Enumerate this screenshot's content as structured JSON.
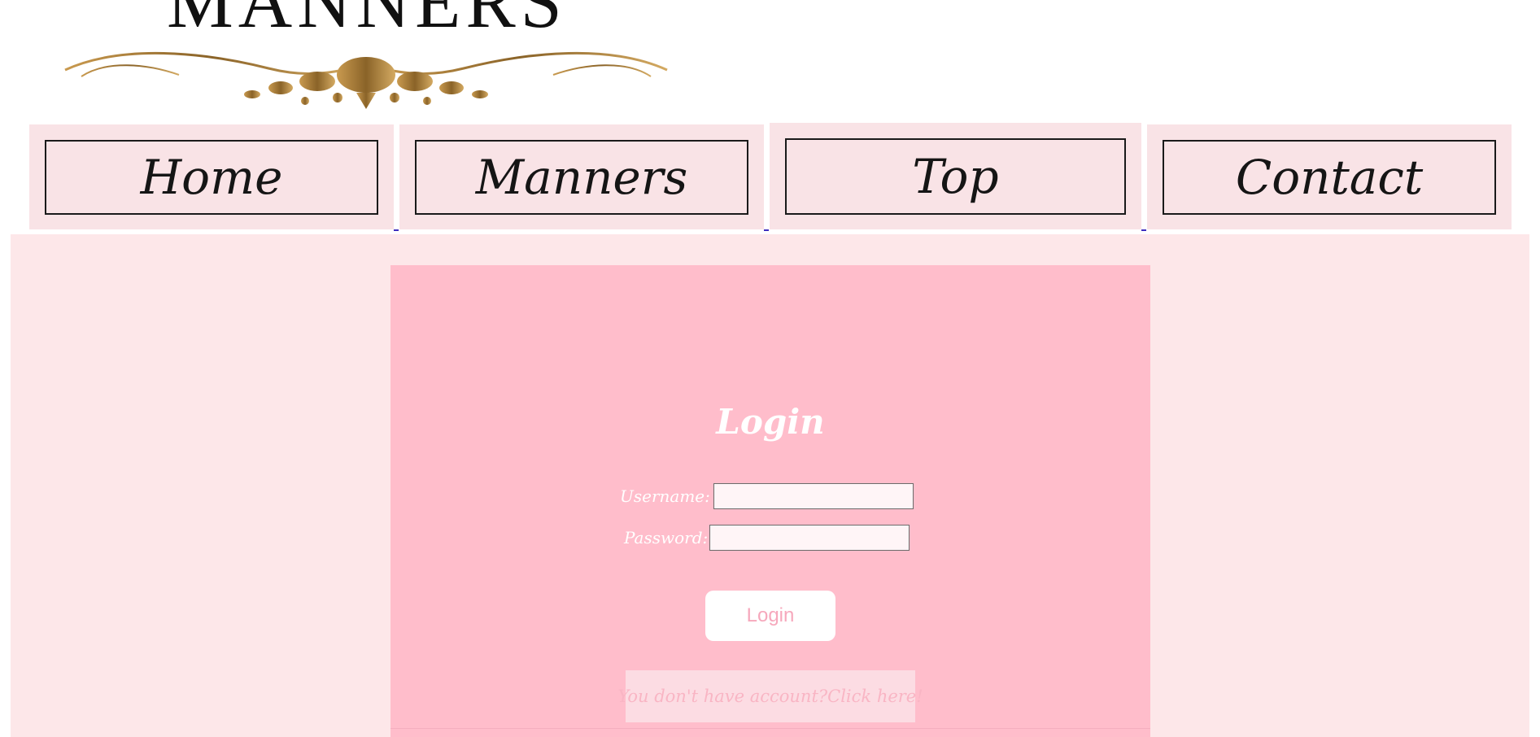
{
  "brand": {
    "logo_text": "MANNERS"
  },
  "nav": {
    "items": [
      {
        "label": "Home"
      },
      {
        "label": "Manners"
      },
      {
        "label": "Top"
      },
      {
        "label": "Contact"
      }
    ]
  },
  "login": {
    "title": "Login",
    "username_label": "Username:",
    "username_value": "",
    "password_label": "Password:",
    "password_value": "",
    "button_label": "Login",
    "signup_text": "You don't have account?Click here!"
  },
  "colors": {
    "nav_tile": "#f9e3e6",
    "content_bg": "#fde7e9",
    "panel": "#ffbdcb",
    "button_text": "#f6a8bc",
    "link_text": "#f9b5c4"
  },
  "icons": [
    "flourish-ornament"
  ]
}
